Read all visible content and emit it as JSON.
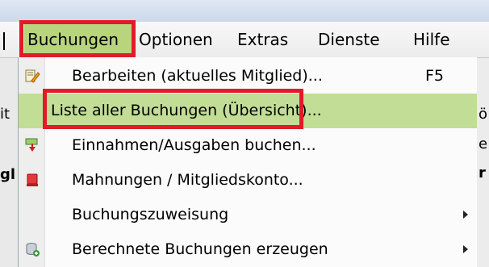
{
  "menubar": {
    "partial_left": "",
    "items": [
      "Buchungen",
      "Optionen",
      "Extras",
      "Dienste",
      "Hilfe"
    ]
  },
  "background": {
    "left_fragments": [
      "it",
      "",
      "gl",
      "",
      "",
      ""
    ],
    "right_fragments": [
      "",
      "ö",
      "e",
      "r",
      "",
      ""
    ]
  },
  "dropdown": {
    "items": [
      {
        "label": "Bearbeiten (aktuelles Mitglied)...",
        "shortcut": "F5",
        "icon": "edit-member-icon",
        "submenu": false
      },
      {
        "label": "Liste aller Buchungen (Übersicht)...",
        "shortcut": "",
        "icon": "",
        "submenu": false,
        "highlighted": true
      },
      {
        "label": "Einnahmen/Ausgaben buchen...",
        "shortcut": "",
        "icon": "income-expense-icon",
        "submenu": false
      },
      {
        "label": "Mahnungen / Mitgliedskonto...",
        "shortcut": "",
        "icon": "reminder-icon",
        "submenu": false
      },
      {
        "label": "Buchungszuweisung",
        "shortcut": "",
        "icon": "",
        "submenu": true
      },
      {
        "label": "Berechnete Buchungen erzeugen",
        "shortcut": "",
        "icon": "generate-bookings-icon",
        "submenu": true
      }
    ]
  },
  "colors": {
    "annotation_red": "#e21a2a",
    "active_green": "#b8d57e",
    "hover_green": "#c2dd96"
  }
}
